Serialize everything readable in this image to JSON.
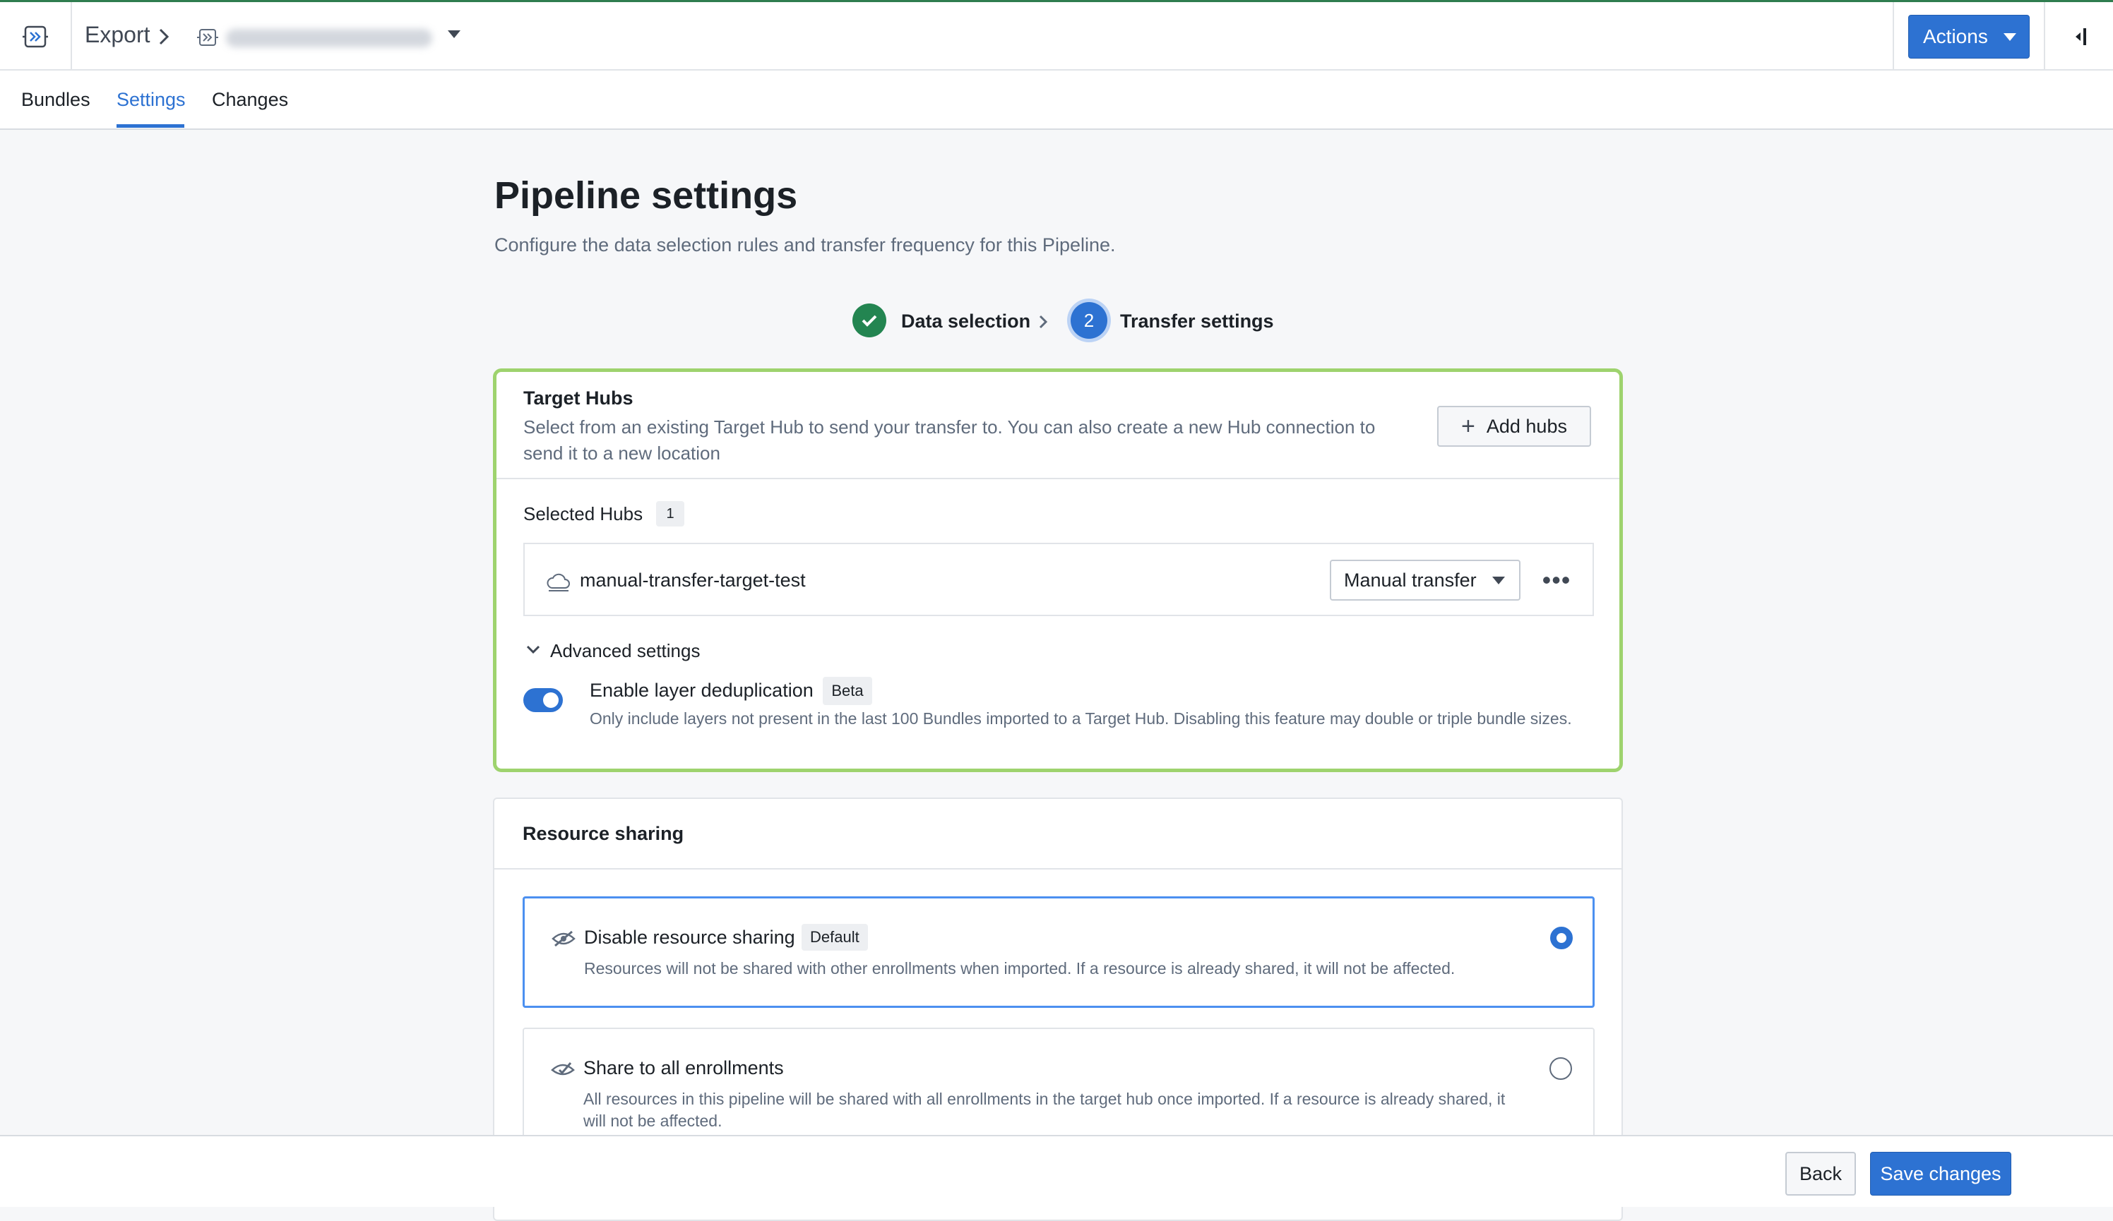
{
  "header": {
    "breadcrumb_root": "Export",
    "actions_label": "Actions"
  },
  "tabs": [
    {
      "label": "Bundles",
      "active": false
    },
    {
      "label": "Settings",
      "active": true
    },
    {
      "label": "Changes",
      "active": false
    }
  ],
  "page": {
    "title": "Pipeline settings",
    "subtitle": "Configure the data selection rules and transfer frequency for this Pipeline."
  },
  "steps": [
    {
      "label": "Data selection",
      "status": "complete"
    },
    {
      "number": "2",
      "label": "Transfer settings",
      "status": "current"
    }
  ],
  "target_hubs": {
    "title": "Target Hubs",
    "description": "Select from an existing Target Hub to send your transfer to. You can also create a new Hub connection to send it to a new location",
    "add_label": "Add hubs",
    "selected_label": "Selected Hubs",
    "selected_count": "1",
    "hubs": [
      {
        "name": "manual-transfer-target-test",
        "mode": "Manual transfer"
      }
    ],
    "advanced_label": "Advanced settings",
    "dedup": {
      "label": "Enable layer deduplication",
      "badge": "Beta",
      "description": "Only include layers not present in the last 100 Bundles imported to a Target Hub. Disabling this feature may double or triple bundle sizes.",
      "enabled": true
    }
  },
  "resource_sharing": {
    "title": "Resource sharing",
    "options": [
      {
        "title": "Disable resource sharing",
        "badge": "Default",
        "description": "Resources will not be shared with other enrollments when imported. If a resource is already shared, it will not be affected.",
        "selected": true
      },
      {
        "title": "Share to all enrollments",
        "description": "All resources in this pipeline will be shared with all enrollments in the target hub once imported. If a resource is already shared, it will not be affected.",
        "selected": false
      }
    ]
  },
  "footer": {
    "back_label": "Back",
    "save_label": "Save changes"
  },
  "colors": {
    "primary": "#2d72d2",
    "success": "#238551",
    "highlight_border": "#9ed36e"
  }
}
